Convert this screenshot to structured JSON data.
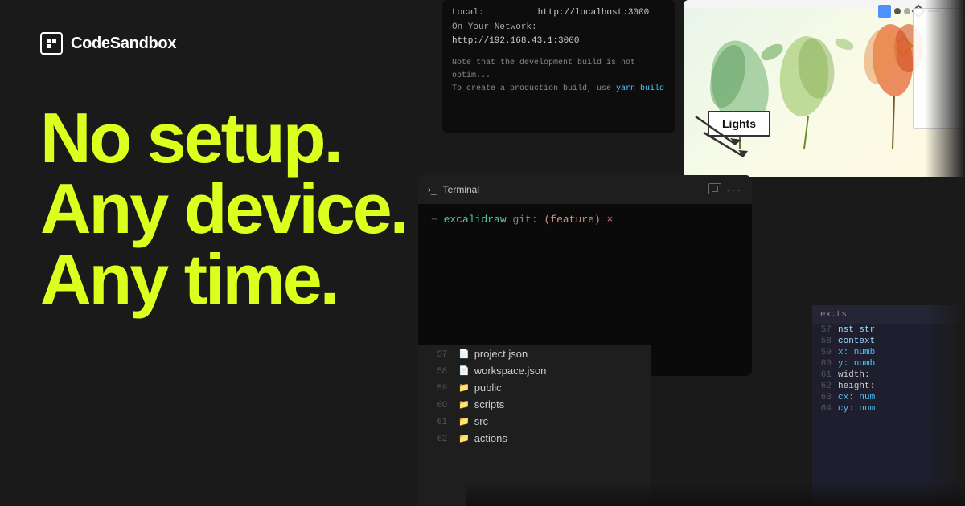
{
  "brand": {
    "logo_text": "CodeSandbox",
    "logo_box_char": "□"
  },
  "hero": {
    "line1": "No setup.",
    "line2": "Any device.",
    "line3": "Any time."
  },
  "dev_server": {
    "local_label": "Local:",
    "local_url": "http://localhost:3000",
    "network_label": "On Your Network:",
    "network_url": "http://192.168.43.1:3000",
    "note_line1": "Note that the development build is not optim...",
    "note_line2": "To create a production build, use ",
    "yarn_cmd": "yarn build"
  },
  "drawing": {
    "lights_label": "Lights"
  },
  "terminal": {
    "title": "Terminal",
    "prompt_tilde": "~",
    "dirname": "excalidraw",
    "git_prefix": "git:",
    "git_branch": "(feature)",
    "git_modified": "×"
  },
  "file_tree": {
    "items": [
      {
        "line": "57",
        "type": "file",
        "name": "project.json"
      },
      {
        "line": "58",
        "type": "file",
        "name": "workspace.json"
      },
      {
        "line": "59",
        "type": "folder",
        "name": "public"
      },
      {
        "line": "60",
        "type": "folder",
        "name": "scripts"
      },
      {
        "line": "61",
        "type": "folder",
        "name": "src"
      },
      {
        "line": "62",
        "type": "folder",
        "name": "actions"
      }
    ]
  },
  "code": {
    "filename": "ex.ts",
    "lines": [
      {
        "num": "57",
        "content": "nst str"
      },
      {
        "num": "58",
        "content": "context"
      },
      {
        "num": "59",
        "content": "x: numb"
      },
      {
        "num": "60",
        "content": "y: numb"
      },
      {
        "num": "61",
        "content": "width:"
      },
      {
        "num": "62",
        "content": "height:"
      },
      {
        "num": "63",
        "content": "cx: num"
      },
      {
        "num": "64",
        "content": "cy: num"
      }
    ]
  }
}
